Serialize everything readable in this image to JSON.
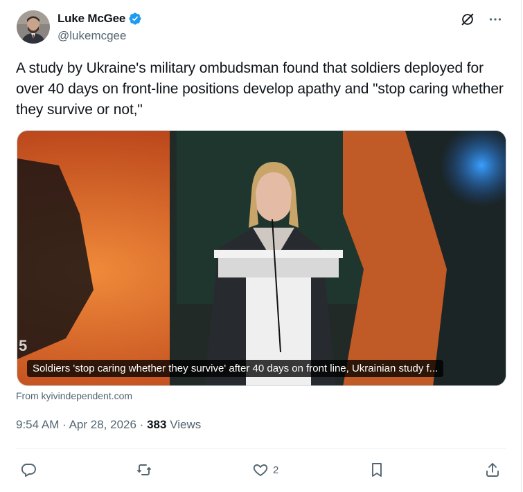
{
  "author": {
    "display_name": "Luke McGee",
    "handle": "@lukemcgee"
  },
  "tweet": {
    "text": "A study by Ukraine's military ombudsman found that soldiers deployed for over 40 days on front-line positions develop apathy and \"stop caring whether they survive or not,\"",
    "card_caption": "Soldiers 'stop caring whether they survive' after 40 days on front line, Ukrainian study f...",
    "card_source": "From kyivindependent.com",
    "media_corner_text": "5"
  },
  "meta": {
    "time": "9:54 AM",
    "sep": "·",
    "date": "Apr 28, 2026",
    "views_count": "383",
    "views_label": "Views"
  },
  "actions": {
    "replies": "",
    "reposts": "",
    "likes": "2",
    "bookmarks": ""
  },
  "icons": [
    "grok-icon",
    "more-icon",
    "verified-badge-icon",
    "reply-icon",
    "repost-icon",
    "like-icon",
    "bookmark-icon",
    "share-icon"
  ],
  "colors": {
    "text": "#0f1419",
    "secondary": "#536471",
    "verified": "#1d9bf0"
  }
}
